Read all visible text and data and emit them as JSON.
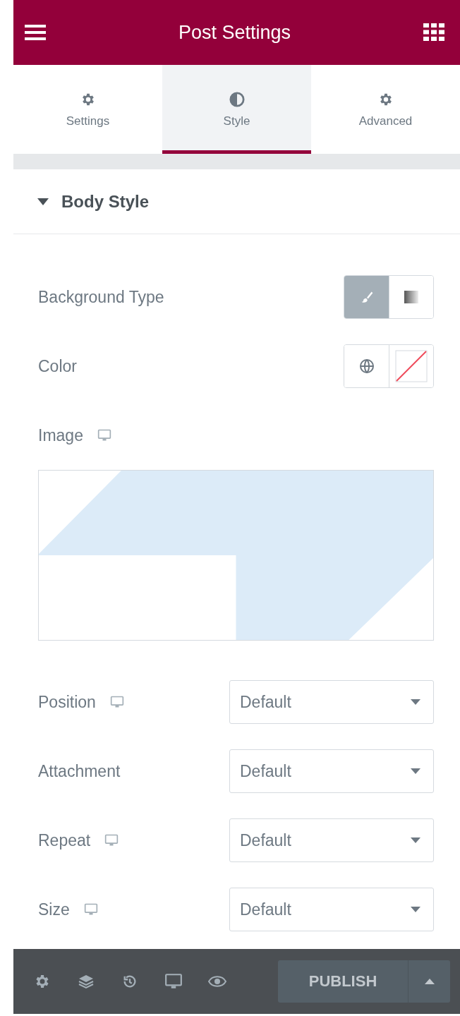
{
  "header": {
    "title": "Post Settings"
  },
  "tabs": [
    {
      "label": "Settings",
      "selected": false
    },
    {
      "label": "Style",
      "selected": true
    },
    {
      "label": "Advanced",
      "selected": false
    }
  ],
  "section": {
    "title": "Body Style",
    "expanded": true
  },
  "controls": [
    {
      "kind": "choose",
      "label": "Background Type",
      "responsive": false,
      "options": [
        {
          "selected": true
        },
        {
          "selected": false
        }
      ]
    },
    {
      "kind": "color",
      "label": "Color",
      "responsive": false
    },
    {
      "kind": "image",
      "label": "Image",
      "responsive": true
    },
    {
      "kind": "select",
      "label": "Position",
      "responsive": true,
      "value": "Default"
    },
    {
      "kind": "select",
      "label": "Attachment",
      "responsive": false,
      "value": "Default"
    },
    {
      "kind": "select",
      "label": "Repeat",
      "responsive": true,
      "value": "Default"
    },
    {
      "kind": "select",
      "label": "Size",
      "responsive": true,
      "value": "Default"
    }
  ],
  "footer": {
    "publish": "PUBLISH"
  }
}
